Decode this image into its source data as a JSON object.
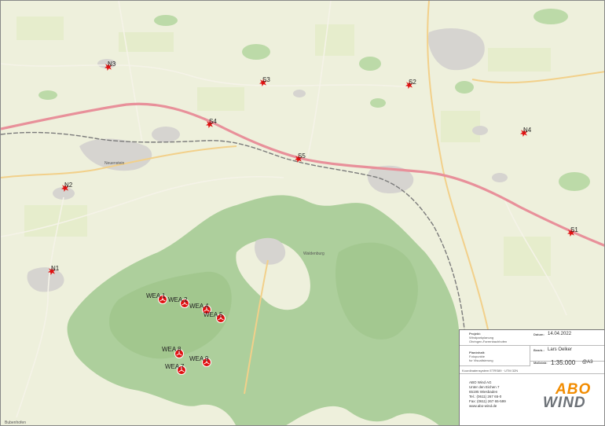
{
  "map": {
    "colors": {
      "field": "#eef0dc",
      "forest": "#adcf9c",
      "settlement": "#d6d4d0",
      "motorway": "#e8909a",
      "road": "#f2d08a",
      "railway": "#7a7a7a",
      "marker": "#e01010"
    },
    "places": [
      {
        "name": "Neuenstein",
        "kind": "town"
      },
      {
        "name": "Waldenburg",
        "kind": "town"
      },
      {
        "name": "Bubenhofen",
        "kind": "village"
      }
    ],
    "markers": [
      {
        "id": "marker-n3",
        "label": "N3",
        "type": "star"
      },
      {
        "id": "marker-s3",
        "label": "S3",
        "type": "star"
      },
      {
        "id": "marker-s2",
        "label": "S2",
        "type": "star"
      },
      {
        "id": "marker-s4",
        "label": "S4",
        "type": "star"
      },
      {
        "id": "marker-n4",
        "label": "N4",
        "type": "star"
      },
      {
        "id": "marker-s5",
        "label": "S5",
        "type": "star"
      },
      {
        "id": "marker-n2",
        "label": "N2",
        "type": "star"
      },
      {
        "id": "marker-s1",
        "label": "S1",
        "type": "star"
      },
      {
        "id": "marker-n1",
        "label": "N1",
        "type": "star"
      },
      {
        "id": "marker-wea1",
        "label": "WEA 1",
        "type": "turbine"
      },
      {
        "id": "marker-wea2",
        "label": "WEA 2",
        "type": "turbine"
      },
      {
        "id": "marker-wea4",
        "label": "WEA 4",
        "type": "turbine"
      },
      {
        "id": "marker-wea5",
        "label": "WEA 5",
        "type": "turbine"
      },
      {
        "id": "marker-wea8",
        "label": "WEA 8",
        "type": "turbine"
      },
      {
        "id": "marker-wea9",
        "label": "WEA 9",
        "type": "turbine"
      },
      {
        "id": "marker-wea7",
        "label": "WEA 7",
        "type": "turbine"
      }
    ]
  },
  "title_block": {
    "project_label": "Projekt:",
    "project_lines": [
      "Windparkplanung",
      "Ohringen-Farrenbachhofen"
    ],
    "date_label": "Datum:",
    "date_value": "14.04.2022",
    "drawn_label": "Bearb.:",
    "drawn_value": "Lars Oelker",
    "content_label": "Planinhalt:",
    "content_lines": [
      "Fotopunkte",
      "fur Visualisierung"
    ],
    "scale_label": "Maßstab:",
    "scale_value": "1:35.000",
    "paper_value": "@A3",
    "crs_text": "Koordinatensystem ETRS89 · UTM 32N",
    "company_lines": [
      "ABO Wind AG",
      "Unter den Eichen 7",
      "65195 Wiesbaden",
      "Tel.: (0611) 267 65-0",
      "Fax: (0611) 267 65-599",
      "www.abo-wind.de"
    ],
    "logo_top": "ABO",
    "logo_bottom": "WIND"
  }
}
